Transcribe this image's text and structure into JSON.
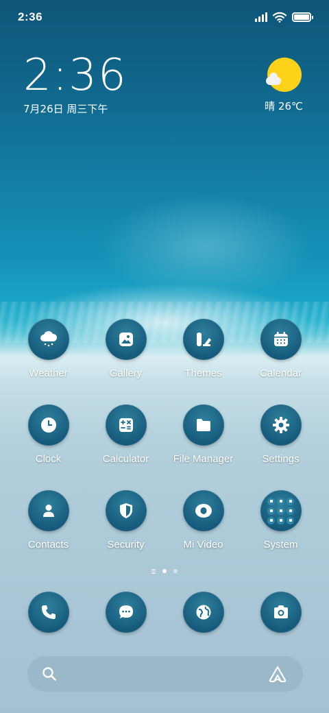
{
  "status_bar": {
    "time": "2:36",
    "battery_level": 1.0,
    "signal_bars": 4
  },
  "clock_widget": {
    "time": "2:36",
    "date": "7月26日 周三下午"
  },
  "weather_widget": {
    "condition_icon": "sun-with-cloud-icon",
    "text": "晴 26℃"
  },
  "apps": [
    {
      "label": "Weather",
      "icon": "weather-cloud-icon"
    },
    {
      "label": "Gallery",
      "icon": "gallery-icon"
    },
    {
      "label": "Themes",
      "icon": "themes-icon"
    },
    {
      "label": "Calendar",
      "icon": "calendar-icon"
    },
    {
      "label": "Clock",
      "icon": "clock-icon"
    },
    {
      "label": "Calculator",
      "icon": "calculator-icon"
    },
    {
      "label": "File Manager",
      "icon": "folder-icon"
    },
    {
      "label": "Settings",
      "icon": "gear-icon"
    },
    {
      "label": "Contacts",
      "icon": "contacts-icon"
    },
    {
      "label": "Security",
      "icon": "shield-icon"
    },
    {
      "label": "Mi Video",
      "icon": "video-icon"
    },
    {
      "label": "System",
      "icon": "folder-grid-icon"
    }
  ],
  "page_indicator": {
    "pages": 2,
    "active_page": 1
  },
  "dock": [
    {
      "icon": "phone-icon"
    },
    {
      "icon": "messages-icon"
    },
    {
      "icon": "browser-globe-icon"
    },
    {
      "icon": "camera-icon"
    }
  ],
  "search_bar": {
    "left_icon": "search-icon",
    "right_icon": "app-vault-icon"
  },
  "colors": {
    "icon_background": "#1b6584",
    "sun": "#ffd21a"
  }
}
